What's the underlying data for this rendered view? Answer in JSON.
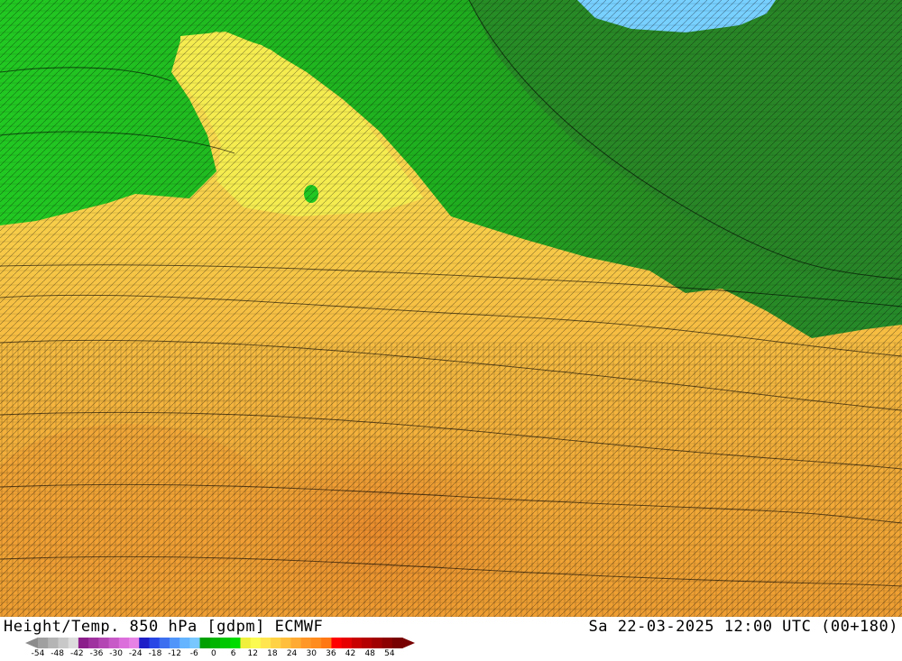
{
  "header": {
    "title": "Height/Temp. 850 hPa [gdpm] ECMWF",
    "datetime": "Sa 22-03-2025 12:00 UTC (00+180)"
  },
  "legend": {
    "ticks": [
      "-54",
      "-48",
      "-42",
      "-36",
      "-30",
      "-24",
      "-18",
      "-12",
      "-6",
      "0",
      "6",
      "12",
      "18",
      "24",
      "30",
      "36",
      "42",
      "48",
      "54"
    ],
    "colors": [
      "#a0a0a0",
      "#b4b4b4",
      "#c8c8c8",
      "#dcdcdc",
      "#8c1e8c",
      "#a032a0",
      "#b446b4",
      "#c85ac8",
      "#dc6edc",
      "#e682e6",
      "#1e1ec8",
      "#2846e6",
      "#3c6ef0",
      "#5096fa",
      "#64b4ff",
      "#78c8ff",
      "#00a000",
      "#00b400",
      "#00c800",
      "#00dc00",
      "#f0f03c",
      "#fafa50",
      "#ffe650",
      "#ffd246",
      "#ffbe3c",
      "#ffaa32",
      "#ff9628",
      "#ff8c1e",
      "#ff7814",
      "#ff0000",
      "#e60000",
      "#c80000",
      "#b40000",
      "#a00000",
      "#8c0000",
      "#780000"
    ]
  },
  "map": {
    "field_colors": {
      "dark_green": "#2a8a24",
      "green": "#22c822",
      "yellow": "#f5ec50",
      "light_orange": "#f8c84a",
      "orange": "#f0a836",
      "deep_orange": "#e8882a",
      "light_blue": "#78d0ff"
    }
  }
}
